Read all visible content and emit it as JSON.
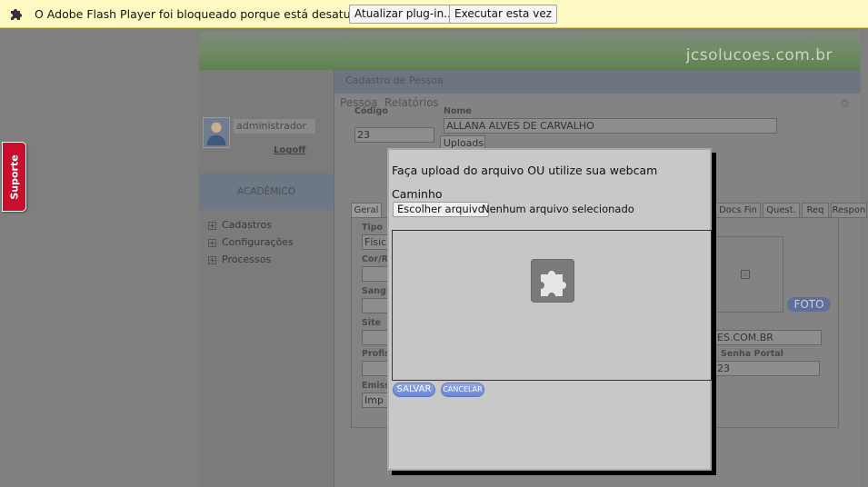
{
  "flash_bar": {
    "message": "O Adobe Flash Player foi bloqueado porque está desatualizado.",
    "update_button": "Atualizar plug-in...",
    "run_button": "Executar esta vez"
  },
  "support_tab": {
    "label": "Suporte"
  },
  "site": {
    "title": "jcsolucoes.com.br"
  },
  "sidebar": {
    "username": "administrador",
    "logoff": "Logoff",
    "section": "ACADÊMICO",
    "items": [
      {
        "label": "Cadastros"
      },
      {
        "label": "Configurações"
      },
      {
        "label": "Processos"
      }
    ]
  },
  "main": {
    "breadcrumb": "Cadastro de Pessoa",
    "menu": [
      "Pessoa",
      "Relatórios"
    ],
    "codigo_label": "Código",
    "codigo_value": "23",
    "nome_label": "Nome",
    "nome_value": "ALLANA ALVES DE CARVALHO",
    "uploads_button": "Uploads",
    "tabs": [
      "Geral",
      "Docs Fin",
      "Quest.",
      "Req",
      "Respon"
    ],
    "tipo_label": "Tipo",
    "tipo_value": "Físic",
    "cor_label": "Cor/R",
    "sangue_label": "Sangu",
    "site_label": "Site",
    "profis_label": "Profis",
    "emiss_label": "Emiss",
    "emiss_value": "Imp",
    "foto_button": "FOTO",
    "email_value": "ES.COM.BR",
    "senha_label": "Senha Portal",
    "senha_value": "23"
  },
  "dialog": {
    "title": "Faça upload do arquivo OU utilize sua webcam",
    "caminho_label": "Caminho",
    "choose_button": "Escolher arquivo",
    "no_file": "Nenhum arquivo selecionado",
    "save_button": "SALVAR",
    "cancel_button": "CANCELAR",
    "plugin_icon": "puzzle-icon"
  },
  "colors": {
    "flash_bar_bg": "#fff9c4",
    "support_red": "#c8102e",
    "pill_blue": "#6a86d6"
  }
}
